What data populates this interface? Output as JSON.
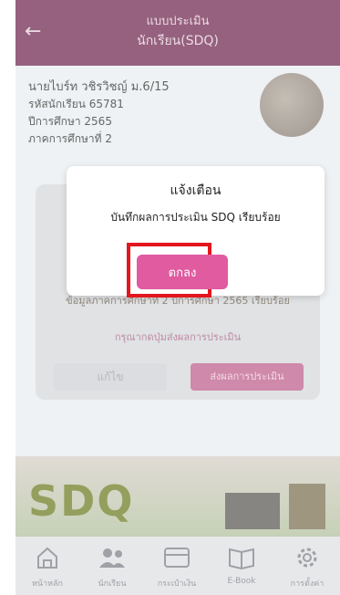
{
  "header": {
    "back_icon": "back-arrow-icon",
    "title_line1": "แบบประเมิน",
    "title_line2": "นักเรียน(SDQ)"
  },
  "profile": {
    "name": "นายไบร์ท วชิรวิชญ์ ม.6/15",
    "student_id": "รหัสนักเรียน 65781",
    "year": "ปีการศึกษา 2565",
    "term": "ภาคการศึกษาที่ 2"
  },
  "card": {
    "status": "ข้อมูลภาคการศึกษาที่ 2 ปีการศึกษา 2565 เรียบร้อย",
    "hint": "กรุณากดปุ่มส่งผลการประเมิน",
    "edit_label": "แก้ไข",
    "send_label": "ส่งผลการประเมิน"
  },
  "banner": {
    "text": "SDQ"
  },
  "nav": {
    "items": [
      {
        "label": "หน้าหลัก",
        "icon": "home-icon"
      },
      {
        "label": "นักเรียน",
        "icon": "users-icon"
      },
      {
        "label": "กระเป๋าเงิน",
        "icon": "wallet-icon"
      },
      {
        "label": "E-Book",
        "icon": "book-icon"
      },
      {
        "label": "การตั้งค่า",
        "icon": "gear-icon"
      }
    ]
  },
  "dialog": {
    "title": "แจ้งเตือน",
    "message": "บันทึกผลการประเมิน SDQ เรียบร้อย",
    "ok_label": "ตกลง"
  },
  "colors": {
    "header": "#7e3f62",
    "accent": "#e05ba0",
    "highlight": "#e3161d"
  }
}
